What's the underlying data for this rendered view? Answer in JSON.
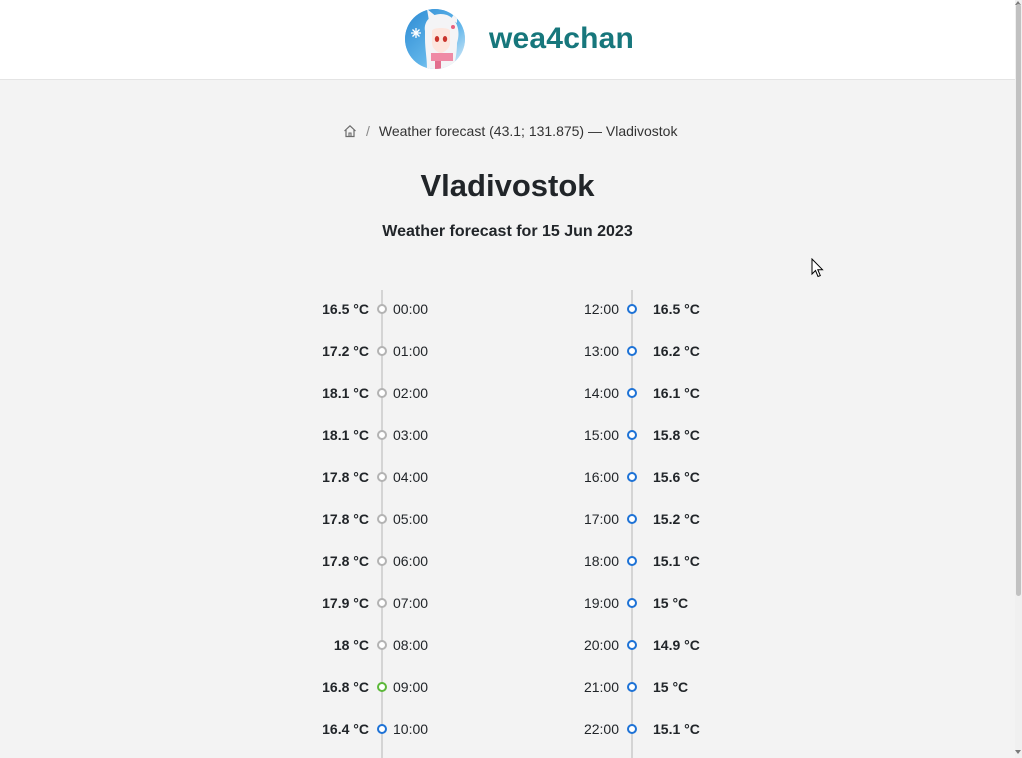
{
  "site": {
    "name": "wea4chan"
  },
  "breadcrumb": {
    "current": "Weather forecast (43.1; 131.875) — Vladivostok"
  },
  "page": {
    "title": "Vladivostok",
    "subtitle": "Weather forecast for 15 Jun 2023"
  },
  "forecast": {
    "left": [
      {
        "temp": "16.5 °C",
        "time": "00:00",
        "state": "past"
      },
      {
        "temp": "17.2 °C",
        "time": "01:00",
        "state": "past"
      },
      {
        "temp": "18.1 °C",
        "time": "02:00",
        "state": "past"
      },
      {
        "temp": "18.1 °C",
        "time": "03:00",
        "state": "past"
      },
      {
        "temp": "17.8 °C",
        "time": "04:00",
        "state": "past"
      },
      {
        "temp": "17.8 °C",
        "time": "05:00",
        "state": "past"
      },
      {
        "temp": "17.8 °C",
        "time": "06:00",
        "state": "past"
      },
      {
        "temp": "17.9 °C",
        "time": "07:00",
        "state": "past"
      },
      {
        "temp": "18 °C",
        "time": "08:00",
        "state": "past"
      },
      {
        "temp": "16.8 °C",
        "time": "09:00",
        "state": "current"
      },
      {
        "temp": "16.4 °C",
        "time": "10:00",
        "state": "future"
      }
    ],
    "right": [
      {
        "time": "12:00",
        "temp": "16.5 °C",
        "state": "future"
      },
      {
        "time": "13:00",
        "temp": "16.2 °C",
        "state": "future"
      },
      {
        "time": "14:00",
        "temp": "16.1 °C",
        "state": "future"
      },
      {
        "time": "15:00",
        "temp": "15.8 °C",
        "state": "future"
      },
      {
        "time": "16:00",
        "temp": "15.6 °C",
        "state": "future"
      },
      {
        "time": "17:00",
        "temp": "15.2 °C",
        "state": "future"
      },
      {
        "time": "18:00",
        "temp": "15.1 °C",
        "state": "future"
      },
      {
        "time": "19:00",
        "temp": "15 °C",
        "state": "future"
      },
      {
        "time": "20:00",
        "temp": "14.9 °C",
        "state": "future"
      },
      {
        "time": "21:00",
        "temp": "15 °C",
        "state": "future"
      },
      {
        "time": "22:00",
        "temp": "15.1 °C",
        "state": "future"
      }
    ]
  },
  "colors": {
    "brand": "#17777c",
    "past_dot": "#b3b3b3",
    "current_dot": "#5cb83a",
    "future_dot": "#1d72d6",
    "background": "#f3f3f3"
  },
  "icons": {
    "logo": "anime-girl-logo-icon",
    "home": "home-icon",
    "cursor": "mouse-cursor-icon"
  }
}
